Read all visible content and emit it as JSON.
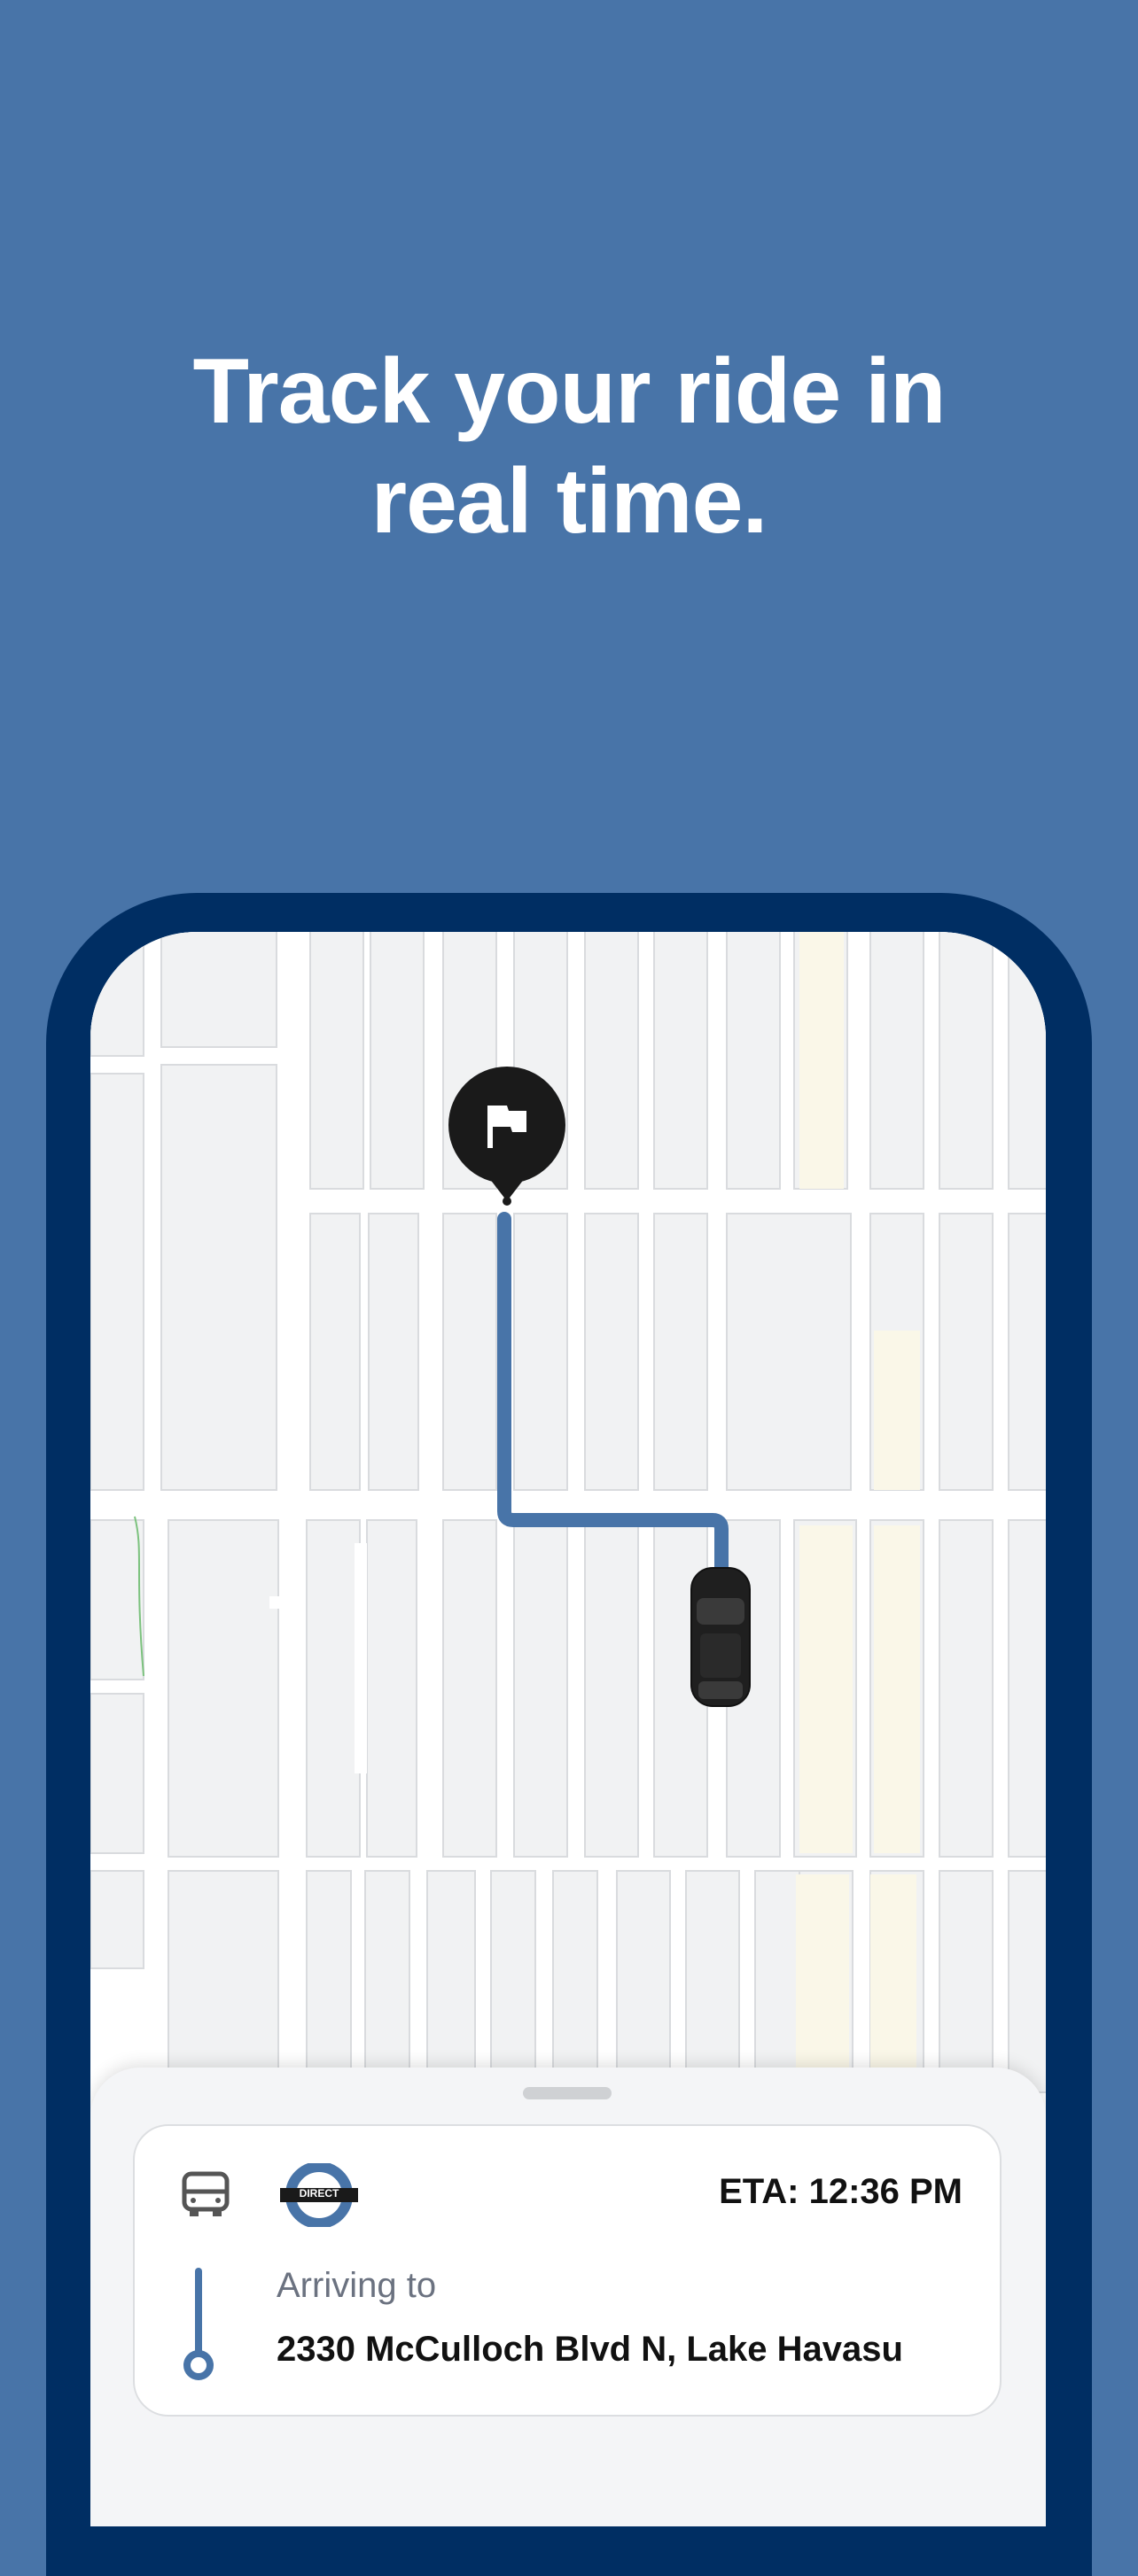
{
  "headline": {
    "line1": "Track your ride in",
    "line2": "real time."
  },
  "map": {
    "destination_icon": "flag-icon",
    "vehicle_icon": "car-icon",
    "route_color": "#4874a8"
  },
  "trip_card": {
    "vehicle_icon": "van-icon",
    "service_logo_text": "DIRECT",
    "eta": "ETA: 12:36 PM",
    "arriving_label": "Arriving to",
    "address": "2330 McCulloch Blvd N, Lake Havasu"
  },
  "colors": {
    "background": "#4874a8",
    "phone_frame": "#002e63",
    "map_block": "#f1f2f3",
    "map_road": "#ffffff",
    "route": "#4874a8",
    "pin": "#1a1a1a"
  }
}
